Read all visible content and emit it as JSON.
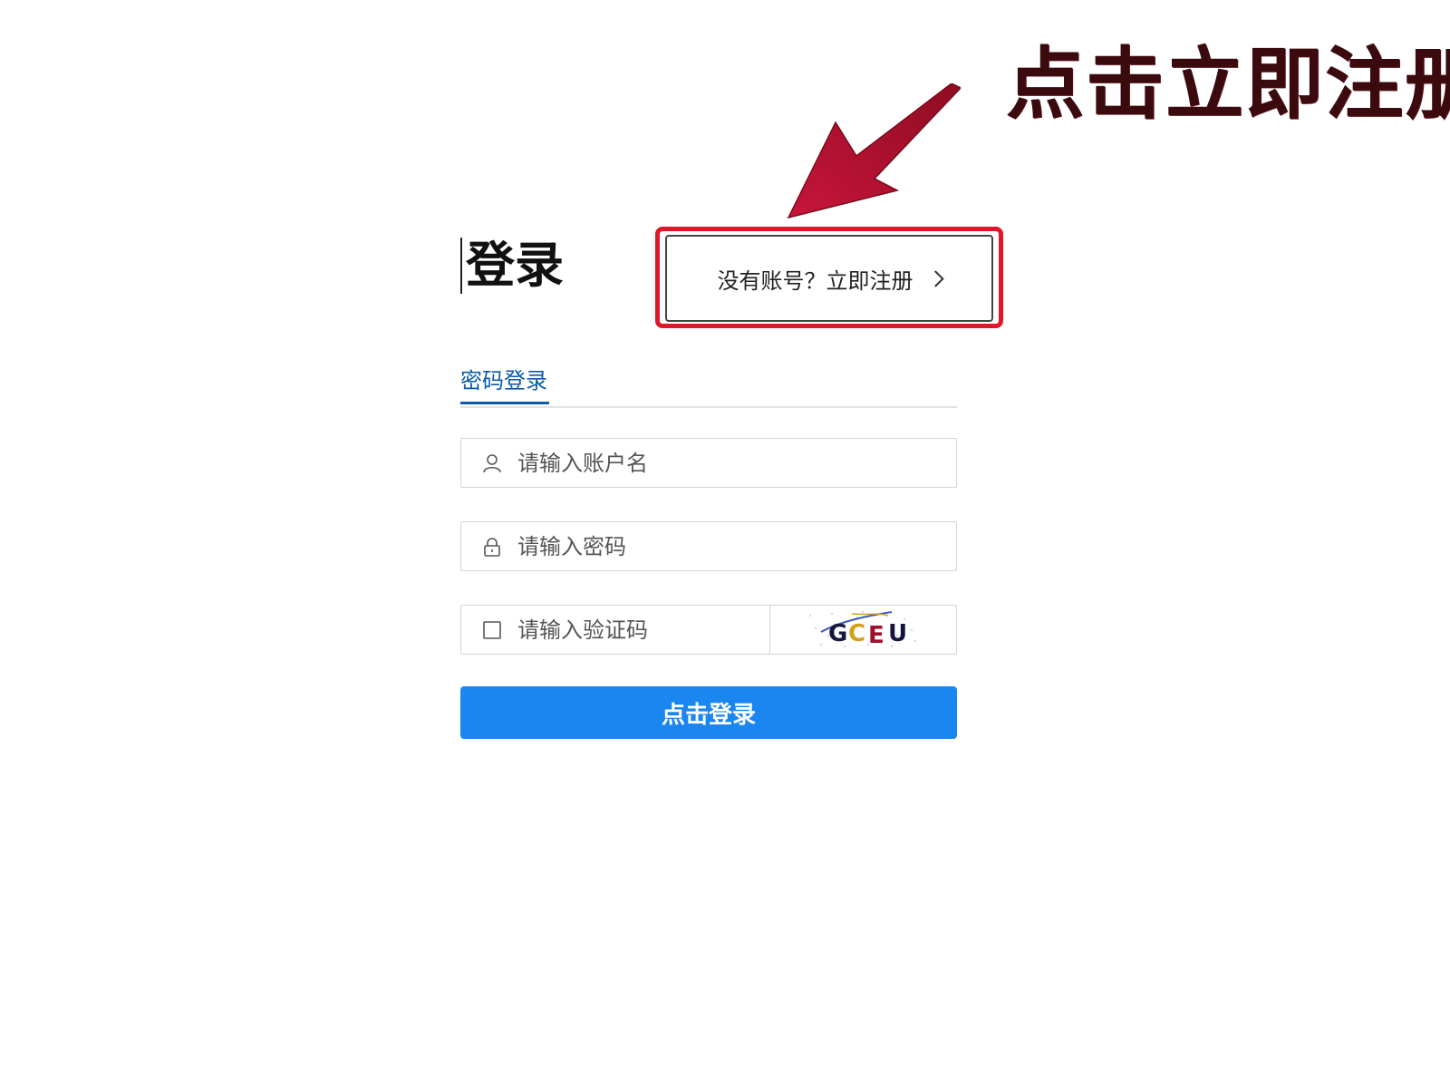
{
  "annotation": {
    "text": "点击立即注册",
    "arrow_color": "#b3112e",
    "box_color": "#e0162b"
  },
  "login": {
    "title": "登录",
    "register_link": "没有账号？立即注册",
    "tab_label": "密码登录",
    "username_placeholder": "请输入账户名",
    "password_placeholder": "请输入密码",
    "captcha_placeholder": "请输入验证码",
    "captcha_code": "GCEU",
    "submit_label": "点击登录"
  },
  "colors": {
    "primary": "#1b86f0",
    "tab_active": "#0d5aa8"
  }
}
